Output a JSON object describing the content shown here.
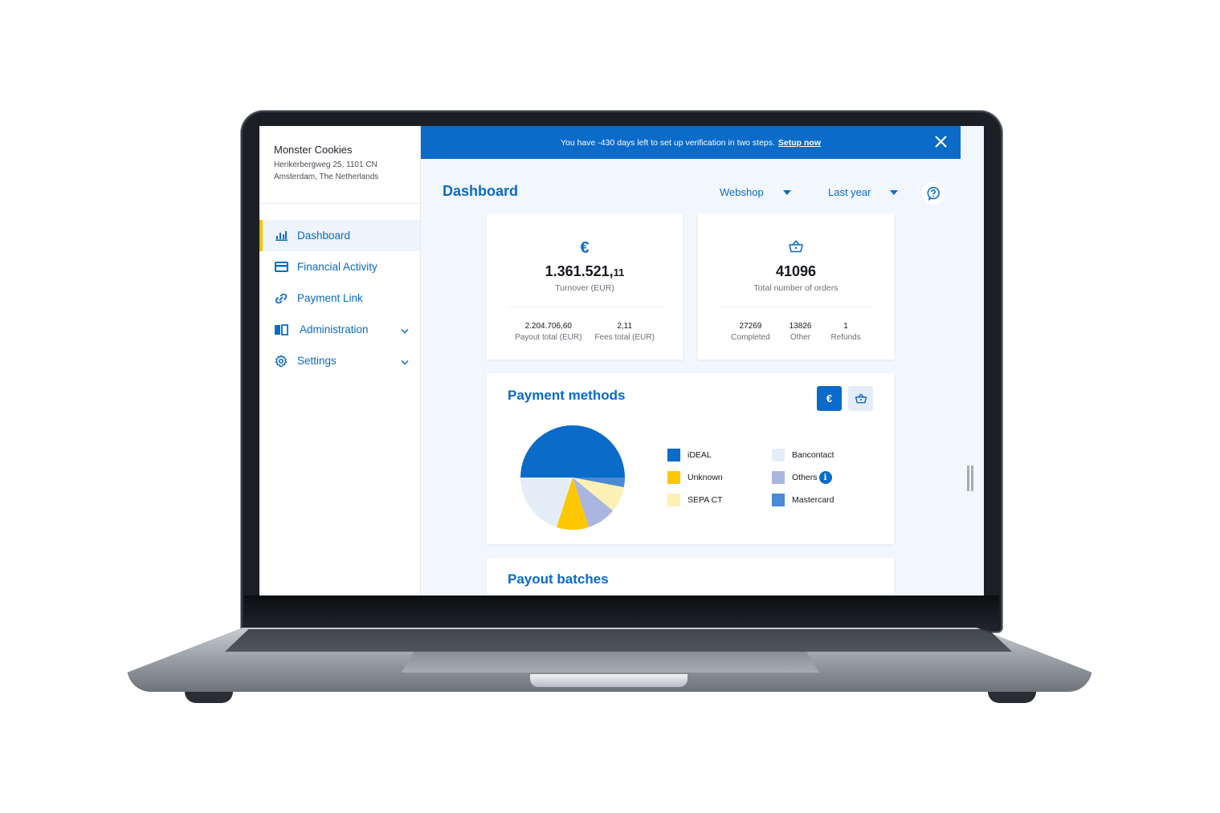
{
  "company": {
    "name": "Monster Cookies",
    "address_line1": "Herikerbergweg 25, 1101 CN",
    "address_line2": "Amsterdam, The Netherlands"
  },
  "sidebar": {
    "items": [
      {
        "label": "Dashboard",
        "icon": "bar-chart-icon",
        "active": true,
        "expandable": false
      },
      {
        "label": "Financial Activity",
        "icon": "credit-card-icon",
        "active": false,
        "expandable": false
      },
      {
        "label": "Payment Link",
        "icon": "link-icon",
        "active": false,
        "expandable": false
      },
      {
        "label": "Administration",
        "icon": "book-icon",
        "active": false,
        "expandable": true
      },
      {
        "label": "Settings",
        "icon": "gear-icon",
        "active": false,
        "expandable": true
      }
    ]
  },
  "banner": {
    "message": "You have -430 days left to set up verification in two steps.",
    "link_label": "Setup now",
    "close_icon": "close-icon"
  },
  "header": {
    "title": "Dashboard",
    "shop_select": "Webshop",
    "period_select": "Last year",
    "help_icon": "help-icon"
  },
  "turnover_card": {
    "icon": "euro-icon",
    "icon_glyph": "€",
    "value_main": "1.361.521,",
    "value_decimals": "11",
    "label": "Turnover (EUR)",
    "substats": [
      {
        "value": "2.204.706,60",
        "label": "Payout total (EUR)"
      },
      {
        "value": "2,11",
        "label": "Fees total (EUR)"
      }
    ]
  },
  "orders_card": {
    "icon": "basket-icon",
    "value": "41096",
    "label": "Total number of orders",
    "substats": [
      {
        "value": "27269",
        "label": "Completed"
      },
      {
        "value": "13826",
        "label": "Other"
      },
      {
        "value": "1",
        "label": "Refunds"
      }
    ]
  },
  "payment_methods": {
    "title": "Payment methods",
    "toggle_euro_glyph": "€",
    "toggle_active": "euro"
  },
  "payout_batches": {
    "title": "Payout batches"
  },
  "colors": {
    "brand": "#0a6bc8",
    "accent": "#f5c000",
    "background": "#f2f7fd"
  },
  "chart_data": {
    "type": "pie",
    "title": "Payment methods",
    "start_angle": "9 o'clock, clockwise",
    "slices": [
      {
        "label": "iDEAL",
        "value": 50,
        "color": "#0a6bc8"
      },
      {
        "label": "Mastercard",
        "value": 3,
        "color": "#4a8ad6"
      },
      {
        "label": "SEPA CT",
        "value": 8,
        "color": "#fdf0b4"
      },
      {
        "label": "Others",
        "value": 9,
        "color": "#aab6e0",
        "info": true
      },
      {
        "label": "Unknown",
        "value": 10,
        "color": "#fdc800"
      },
      {
        "label": "Bancontact",
        "value": 20,
        "color": "#e4eef8"
      }
    ],
    "legend_order": [
      "iDEAL",
      "Bancontact",
      "Unknown",
      "Others",
      "SEPA CT",
      "Mastercard"
    ],
    "legend_placement": "right"
  }
}
